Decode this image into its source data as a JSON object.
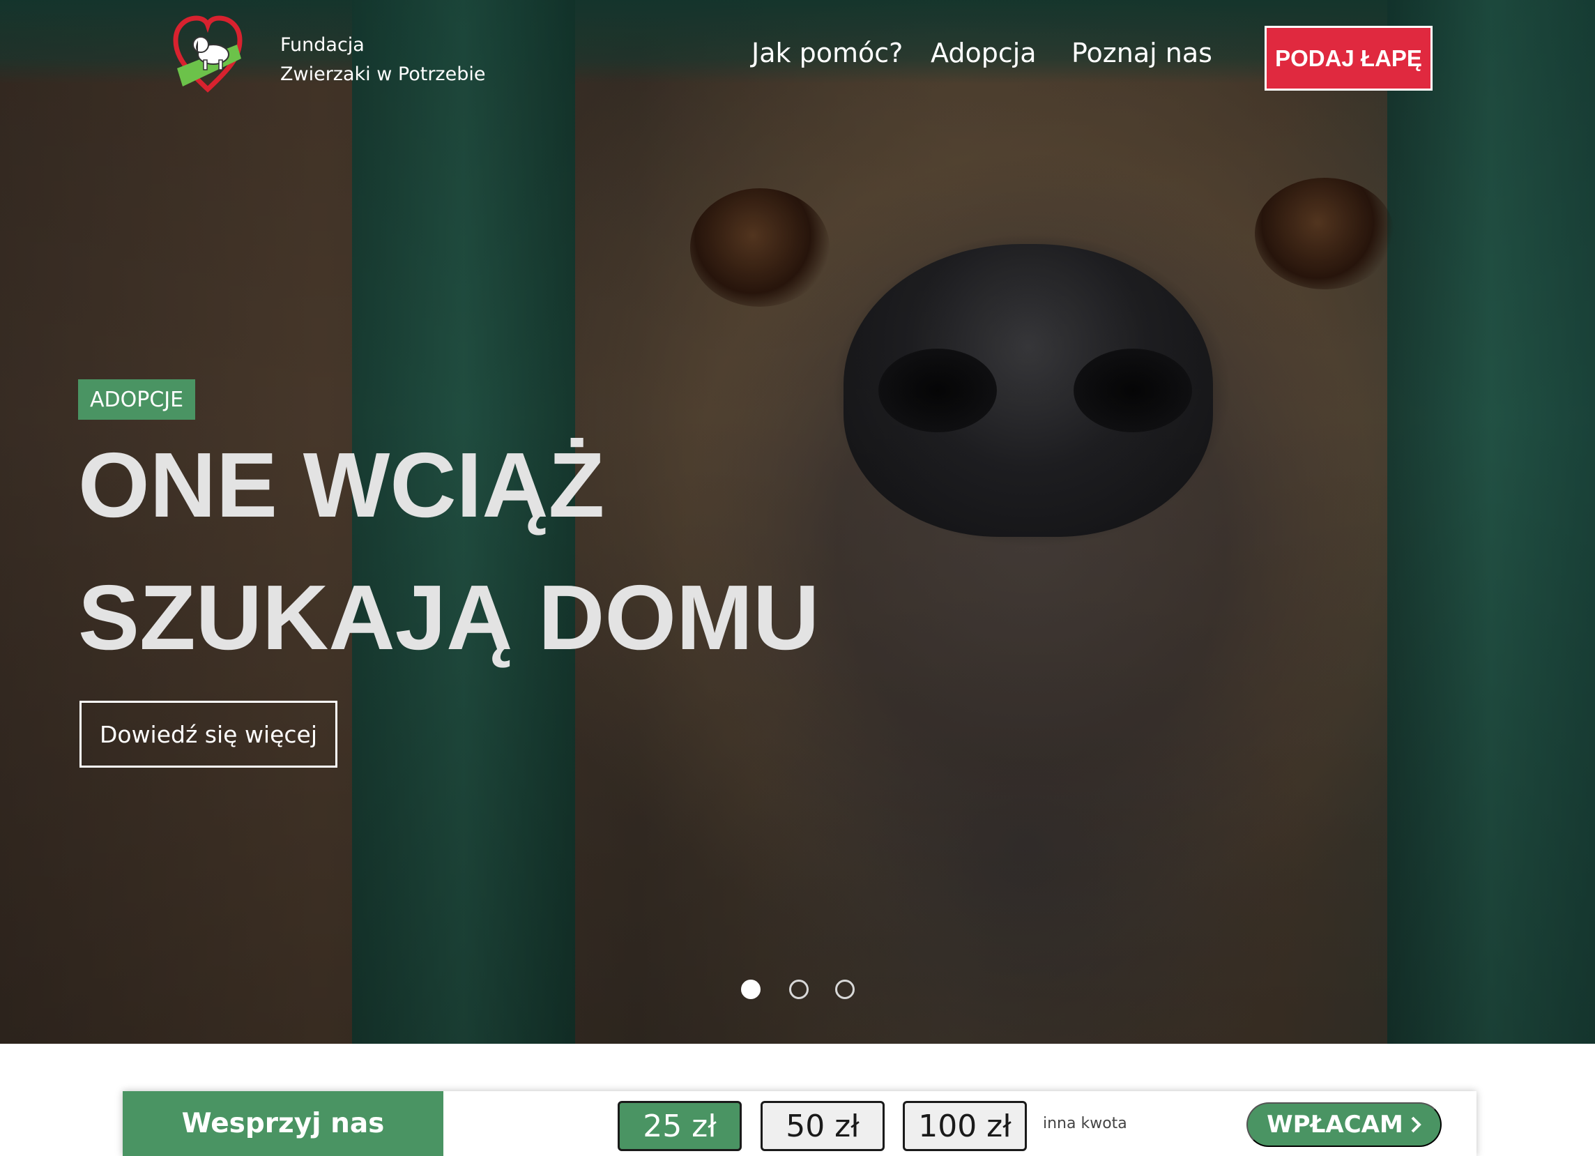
{
  "brand": {
    "name_line1": "Fundacja",
    "name_line2": "Zwierzaki w Potrzebie",
    "colors": {
      "accent_green": "#4a9463",
      "accent_red": "#e0293f"
    }
  },
  "nav": {
    "items": [
      {
        "label": "Jak pomóc?"
      },
      {
        "label": "Adopcja"
      },
      {
        "label": "Poznaj nas"
      }
    ],
    "cta_label": "PODAJ ŁAPĘ"
  },
  "hero": {
    "badge": "ADOPCJE",
    "headline_line1": "ONE WCIĄŻ",
    "headline_line2": "SZUKAJĄ DOMU",
    "button_label": "Dowiedź się więcej",
    "slides_total": 3,
    "active_slide": 1
  },
  "donate": {
    "label": "Wesprzyj nas",
    "amounts": [
      "25 zł",
      "50 zł",
      "100 zł"
    ],
    "selected_amount": "25 zł",
    "other_label": "inna kwota",
    "submit_label": "WPŁACAM",
    "submit_icon": "chevron-right-icon"
  }
}
